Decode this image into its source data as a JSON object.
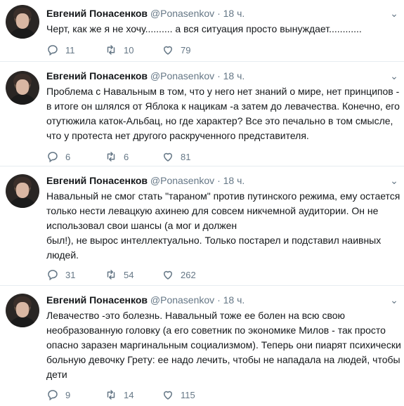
{
  "author": {
    "name": "Евгений Понасенков",
    "handle": "@Ponasenkov",
    "separator": "·",
    "time": "18 ч."
  },
  "tweets": [
    {
      "text": "Черт, как же я не хочу.......... а вся ситуация просто вынуждает............",
      "replies": "11",
      "retweets": "10",
      "likes": "79"
    },
    {
      "text": "Проблема с Навальным в том, что у него нет знаний о мире, нет принципов -\nв итоге он шлялся от Яблока к нацикам -а затем до левачества. Конечно, его\nотутюжила каток-Альбац, но где характер? Все это печально в том смысле,\nчто у протеста нет другого раскрученного представителя.",
      "replies": "6",
      "retweets": "6",
      "likes": "81"
    },
    {
      "text": "Навальный не смог стать \"тараном\" против путинского режима, ему остается\nтолько нести левацкую ахинею для совсем никчемной аудитории. Он не\nиспользовал свои шансы (а мог и должен\nбыл!), не вырос интеллектуально. Только постарел и подставил наивных\nлюдей.",
      "replies": "31",
      "retweets": "54",
      "likes": "262"
    },
    {
      "text": "Левачество -это болезнь. Навальный тоже ее болен на всю свою\nнеобразованную головку (а его советник по экономике Милов - так просто\nопасно заразен маргинальным социализмом). Теперь они пиарят психически\nбольную девочку Грету: ее надо лечить, чтобы не нападала на людей, чтобы\nдети",
      "replies": "9",
      "retweets": "14",
      "likes": "115"
    }
  ]
}
